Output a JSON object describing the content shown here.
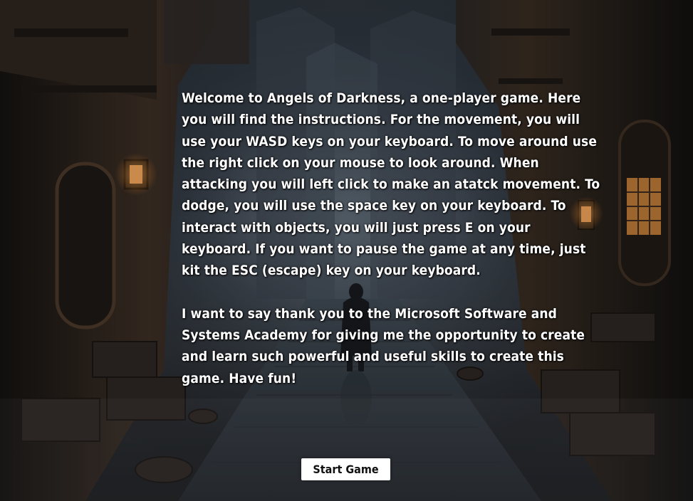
{
  "instructions": {
    "paragraph_1": "Welcome to Angels of Darkness, a one-player game. Here you will find the instructions. For the movement, you will use your WASD keys on your keyboard. To move around use the right click on your mouse to look around. When attacking you will left click to make an atatck movement. To dodge, you will use the space key on your keyboard. To interact with objects, you will just press E on your keyboard. If you want to pause the game at any time, just kit the ESC (escape) key on your keyboard.",
    "paragraph_2": "I want to say thank you to the Microsoft Software and Systems Academy for giving me the opportunity to create and learn such powerful and useful skills to create this game. Have fun!"
  },
  "start_button": {
    "label": "Start Game"
  },
  "colors": {
    "text": "#ffffff",
    "button_bg": "#ffffff",
    "button_text": "#111111",
    "window_glow": "#e08a35"
  }
}
